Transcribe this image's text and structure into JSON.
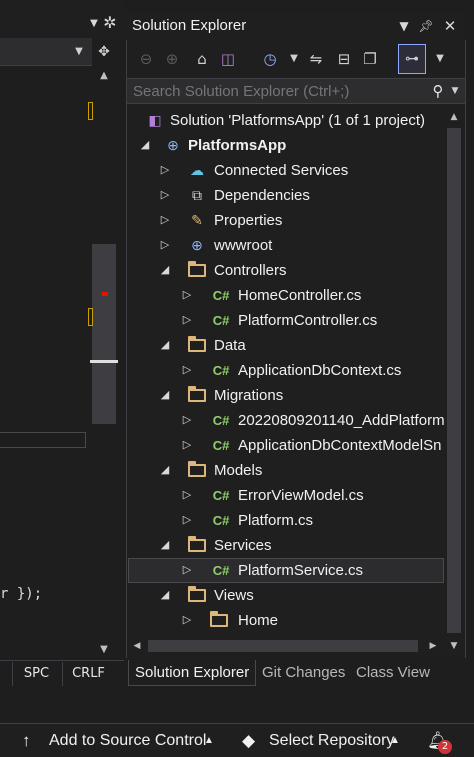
{
  "editor": {
    "split_icon": "split-icon",
    "code_fragment": "r });",
    "status": {
      "spc": "SPC",
      "crlf": "CRLF"
    }
  },
  "panel": {
    "title": "Solution Explorer",
    "search_placeholder": "Search Solution Explorer (Ctrl+;)"
  },
  "tree": {
    "solution": "Solution 'PlatformsApp' (1 of 1 project)",
    "project": "PlatformsApp",
    "items": [
      {
        "label": "Connected Services",
        "icon": "connected-services-icon",
        "expanded": false
      },
      {
        "label": "Dependencies",
        "icon": "dependencies-icon",
        "expanded": false
      },
      {
        "label": "Properties",
        "icon": "wrench-icon",
        "expanded": false
      },
      {
        "label": "wwwroot",
        "icon": "globe-icon",
        "expanded": false
      },
      {
        "label": "Controllers",
        "icon": "folder-icon",
        "expanded": true
      },
      {
        "label": "HomeController.cs",
        "icon": "csharp-file-icon"
      },
      {
        "label": "PlatformController.cs",
        "icon": "csharp-file-icon"
      },
      {
        "label": "Data",
        "icon": "folder-icon",
        "expanded": true
      },
      {
        "label": "ApplicationDbContext.cs",
        "icon": "csharp-file-icon"
      },
      {
        "label": "Migrations",
        "icon": "folder-icon",
        "expanded": true
      },
      {
        "label": "20220809201140_AddPlatform",
        "icon": "csharp-file-icon"
      },
      {
        "label": "ApplicationDbContextModelSn",
        "icon": "csharp-file-icon"
      },
      {
        "label": "Models",
        "icon": "folder-icon",
        "expanded": true
      },
      {
        "label": "ErrorViewModel.cs",
        "icon": "csharp-file-icon"
      },
      {
        "label": "Platform.cs",
        "icon": "csharp-file-icon"
      },
      {
        "label": "Services",
        "icon": "folder-icon",
        "expanded": true
      },
      {
        "label": "PlatformService.cs",
        "icon": "csharp-file-icon",
        "selected": true
      },
      {
        "label": "Views",
        "icon": "folder-icon",
        "expanded": true
      },
      {
        "label": "Home",
        "icon": "folder-icon",
        "expanded": false
      }
    ],
    "cs_glyph": "C#"
  },
  "tabs": [
    "Solution Explorer",
    "Git Changes",
    "Class View"
  ],
  "statusbar": {
    "source_control": "Add to Source Control",
    "repository": "Select Repository",
    "notifications": "2"
  },
  "colors": {
    "background": "#1e1e1e",
    "panel": "#1f1f1f",
    "folder": "#dcb67a",
    "csharp": "#8fcf6a",
    "badge": "#d13438"
  }
}
